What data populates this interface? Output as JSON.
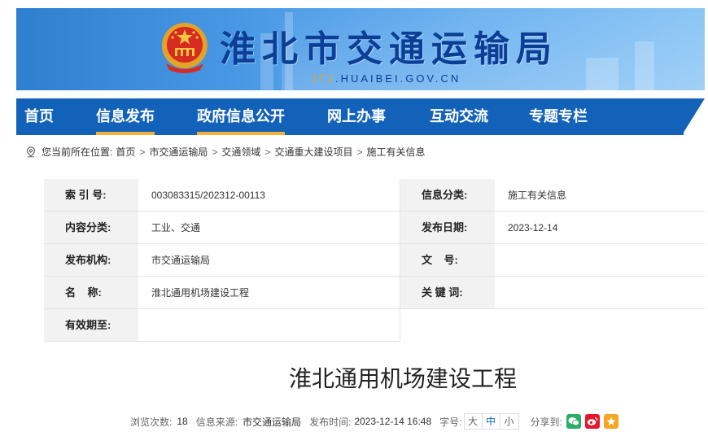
{
  "header": {
    "site_title": "淮北市交通运输局",
    "domain_highlight": "JTJ",
    "domain_rest": ".HUAIBEI.GOV.CN"
  },
  "nav": {
    "items": [
      {
        "label": "首页",
        "active": false
      },
      {
        "label": "信息发布",
        "active": true
      },
      {
        "label": "政府信息公开",
        "active": true
      },
      {
        "label": "网上办事",
        "active": false
      },
      {
        "label": "互动交流",
        "active": false
      },
      {
        "label": "专题专栏",
        "active": false
      }
    ]
  },
  "breadcrumb": {
    "prefix": "您当前所在位置:",
    "items": [
      "首页",
      "市交通运输局",
      "交通领域",
      "交通重大建设项目",
      "施工有关信息"
    ],
    "separator": ">"
  },
  "info": {
    "index_label": "索 引 号:",
    "index_value": "003083315/202312-00113",
    "category_label": "信息分类:",
    "category_value": "施工有关信息",
    "content_label": "内容分类:",
    "content_value": "工业、交通",
    "date_label": "发布日期:",
    "date_value": "2023-12-14",
    "org_label": "发布机构:",
    "org_value": "市交通运输局",
    "docno_label": "文    号:",
    "docno_value": "",
    "name_label": "名    称:",
    "name_value": "淮北通用机场建设工程",
    "keyword_label": "关 键 词:",
    "keyword_value": "",
    "valid_label": "有效期至:",
    "valid_value": ""
  },
  "article": {
    "title": "淮北通用机场建设工程"
  },
  "meta": {
    "views_label": "浏览次数:",
    "views_value": "18",
    "source_label": "信息来源:",
    "source_value": "市交通运输局",
    "time_label": "发布时间:",
    "time_value": "2023-12-14 16:48",
    "fontsize_label": "字号:",
    "fontsize_options": [
      "大",
      "中",
      "小"
    ],
    "fontsize_selected": "中",
    "share_label": "分享到:"
  },
  "colors": {
    "nav_bg": "#1362b9",
    "nav_active_underline": "#f2b23a",
    "title_blue": "#0b3f97",
    "wechat": "#2aae67",
    "weibo": "#e6162d",
    "qzone": "#f5a623"
  },
  "icons": {
    "emblem": "national-emblem-icon",
    "location": "location-pin-icon",
    "wechat": "wechat-icon",
    "weibo": "weibo-icon",
    "qzone": "qzone-star-icon"
  }
}
